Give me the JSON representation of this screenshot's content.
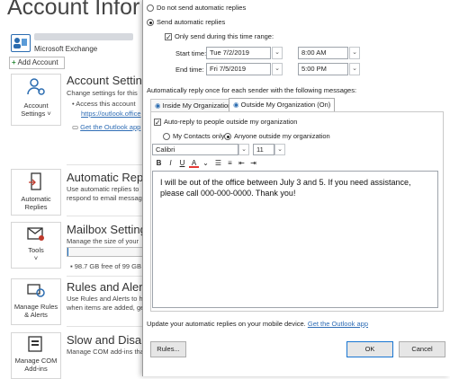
{
  "backstage": {
    "page_title": "Account Infor",
    "account_type": "Microsoft Exchange",
    "add_account_label": "Add Account",
    "tiles": [
      {
        "label": "Account Settings ˅",
        "icon": "person-gear-icon"
      },
      {
        "label": "Automatic Replies",
        "icon": "door-arrow-icon"
      },
      {
        "label": "Tools",
        "icon": "envelope-tools-icon",
        "extra": "˅"
      },
      {
        "label": "Manage Rules & Alerts",
        "icon": "rules-gear-icon"
      },
      {
        "label": "Manage COM Add-ins",
        "icon": "com-addin-icon"
      }
    ],
    "sections": {
      "account_settings": {
        "title": "Account Settings",
        "desc1": "Change settings for this",
        "bullet1": "Access this account",
        "link1": "https://outlook.office",
        "link2": "Get the Outlook app"
      },
      "auto_replies": {
        "title": "Automatic Replies",
        "desc1": "Use automatic replies to",
        "desc2": "respond to email messag"
      },
      "mailbox": {
        "title": "Mailbox Settings",
        "desc1": "Manage the size of your",
        "free_text": "98.7 GB free of 99 GB",
        "used_fraction": 0.01
      },
      "rules": {
        "title": "Rules and Alerts",
        "desc1": "Use Rules and Alerts to h",
        "desc2": "when items are added, ge"
      },
      "com": {
        "title": "Slow and Disable",
        "desc1": "Manage COM add-ins tha"
      }
    }
  },
  "dialog": {
    "no_auto_label": "Do not send automatic replies",
    "send_auto_label": "Send automatic replies",
    "only_range_label": "Only send during this time range:",
    "start_label": "Start time:",
    "start_date": "Tue 7/2/2019",
    "start_time": "8:00 AM",
    "end_label": "End time:",
    "end_date": "Fri 7/5/2019",
    "end_time": "5:00 PM",
    "once_label": "Automatically reply once for each sender with the following messages:",
    "tab_inside": "Inside My Organization",
    "tab_outside": "Outside My Organization (On)",
    "auto_outside_label": "Auto-reply to people outside my organization",
    "contacts_only_label": "My Contacts only",
    "anyone_label": "Anyone outside my organization",
    "font_name": "Calibri",
    "font_size": "11",
    "fmt_bold": "B",
    "fmt_italic": "I",
    "fmt_underline": "U",
    "fmt_color": "A",
    "message": "I will be out of the office between July 3 and 5. If you need assistance, please call 000-000-0000. Thank you!",
    "mobile_text": "Update your automatic replies on your mobile device.",
    "mobile_link": "Get the Outlook app",
    "rules_button": "Rules...",
    "ok_button": "OK",
    "cancel_button": "Cancel"
  },
  "colors": {
    "accent": "#1e73c8",
    "link": "#2f6db5"
  }
}
